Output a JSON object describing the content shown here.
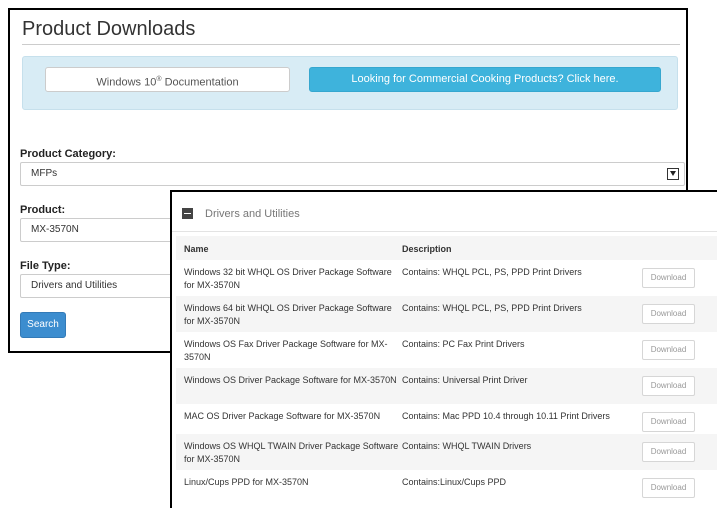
{
  "back": {
    "title": "Product Downloads",
    "doc_button_text": "Windows 10",
    "doc_button_sup": "®",
    "doc_button_suffix": " Documentation",
    "commercial_button": "Looking for Commercial Cooking Products? Click here.",
    "category_label": "Product Category:",
    "category_value": "MFPs",
    "product_label": "Product:",
    "product_value": "MX-3570N",
    "filetype_label": "File Type:",
    "filetype_value": "Drivers and Utilities",
    "search_label": "Search"
  },
  "front": {
    "title": "Drivers and Utilities",
    "col_name": "Name",
    "col_desc": "Description",
    "rows": [
      {
        "name": "Windows 32 bit WHQL OS Driver Package Software for MX-3570N",
        "desc": "Contains: WHQL PCL, PS, PPD Print Drivers",
        "button": "Download"
      },
      {
        "name": "Windows 64 bit WHQL OS Driver Package Software for MX-3570N",
        "desc": "Contains: WHQL PCL, PS, PPD Print Drivers",
        "button": "Download"
      },
      {
        "name": "Windows OS Fax Driver Package Software for MX-3570N",
        "desc": "Contains: PC Fax Print Drivers",
        "button": "Download"
      },
      {
        "name": "Windows OS Driver Package Software for MX-3570N",
        "desc": "Contains: Universal Print Driver",
        "button": "Download"
      },
      {
        "name": "MAC OS Driver Package Software for MX-3570N",
        "desc": "Contains: Mac PPD 10.4 through 10.11 Print Drivers",
        "button": "Download"
      },
      {
        "name": "Windows OS WHQL TWAIN Driver Package Software for MX-3570N",
        "desc": "Contains: WHQL TWAIN Drivers",
        "button": "Download"
      },
      {
        "name": "Linux/Cups PPD for MX-3570N",
        "desc": "Contains:Linux/Cups PPD",
        "button": "Download"
      }
    ]
  }
}
